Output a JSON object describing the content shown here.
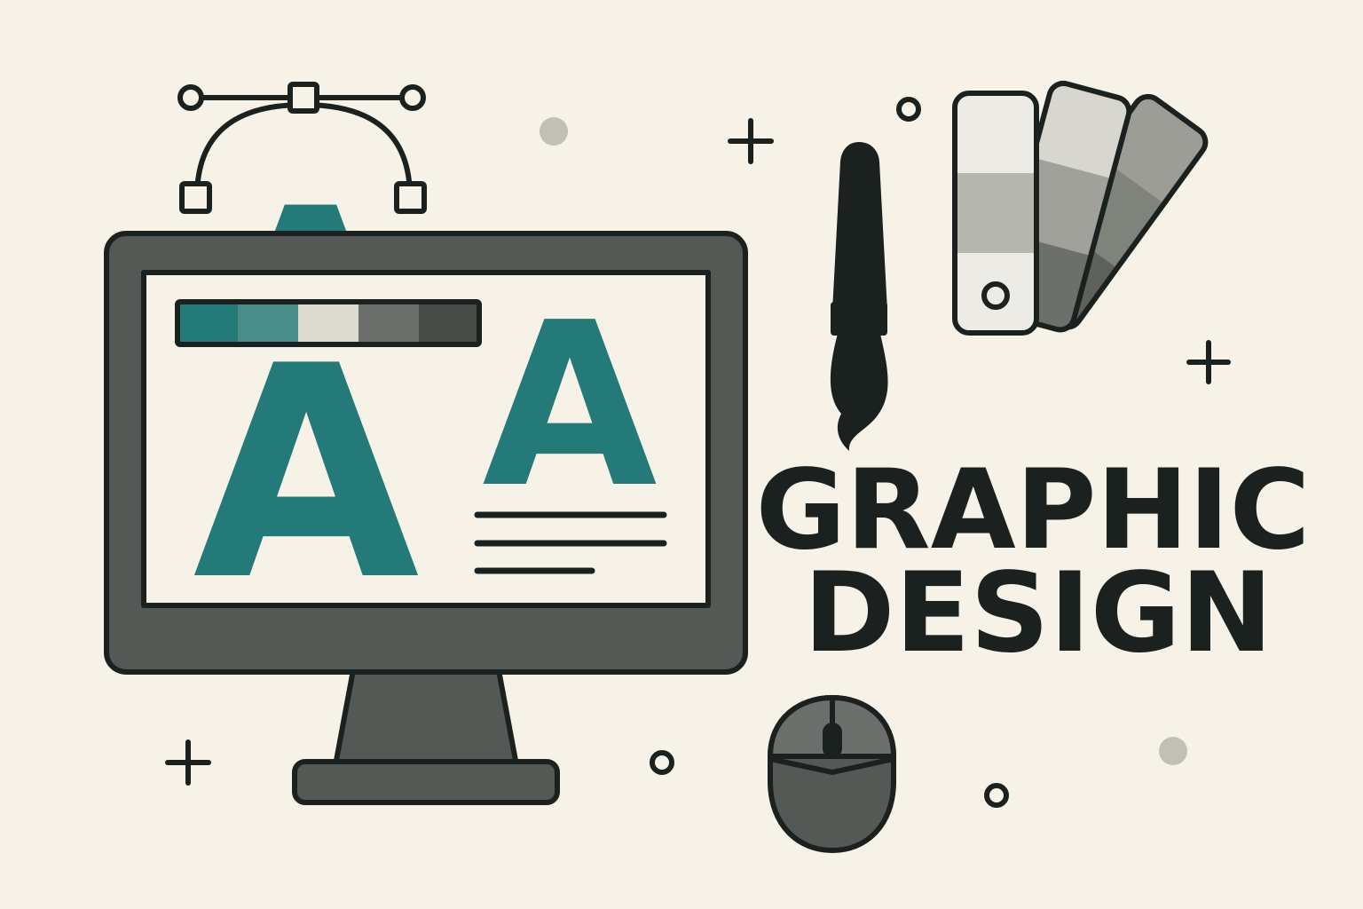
{
  "title": {
    "line1": "GRAPHIC",
    "line2": "DESIGN"
  },
  "screen": {
    "large_letter": "A",
    "small_letter": "A"
  },
  "peeking_letter": "A",
  "palette": {
    "swatches": [
      "#247a78",
      "#4a8d88",
      "#dddbd1",
      "#6c6f6b",
      "#474a47"
    ]
  },
  "fan_deck": {
    "card_back": [
      "#9c9d97",
      "#80827c",
      "#5f615d"
    ],
    "card_middle": [
      "#d7d6cf",
      "#9fa19a",
      "#6d6f6b"
    ],
    "card_front": [
      "#ecebe5",
      "#b5b6ae",
      "#ecebe5"
    ]
  },
  "colors": {
    "background": "#f7f2e7",
    "ink": "#1a211f",
    "accent": "#247a78",
    "monitor": "#555955",
    "screen": "#f7f2e7",
    "dot": "#c2c0b6"
  },
  "icons": [
    "bezier-pen-icon",
    "monitor-icon",
    "paintbrush-icon",
    "color-swatch-fan-icon",
    "mouse-icon",
    "plus-sparkle-icon",
    "circle-sparkle-icon",
    "dot-sparkle-icon"
  ]
}
